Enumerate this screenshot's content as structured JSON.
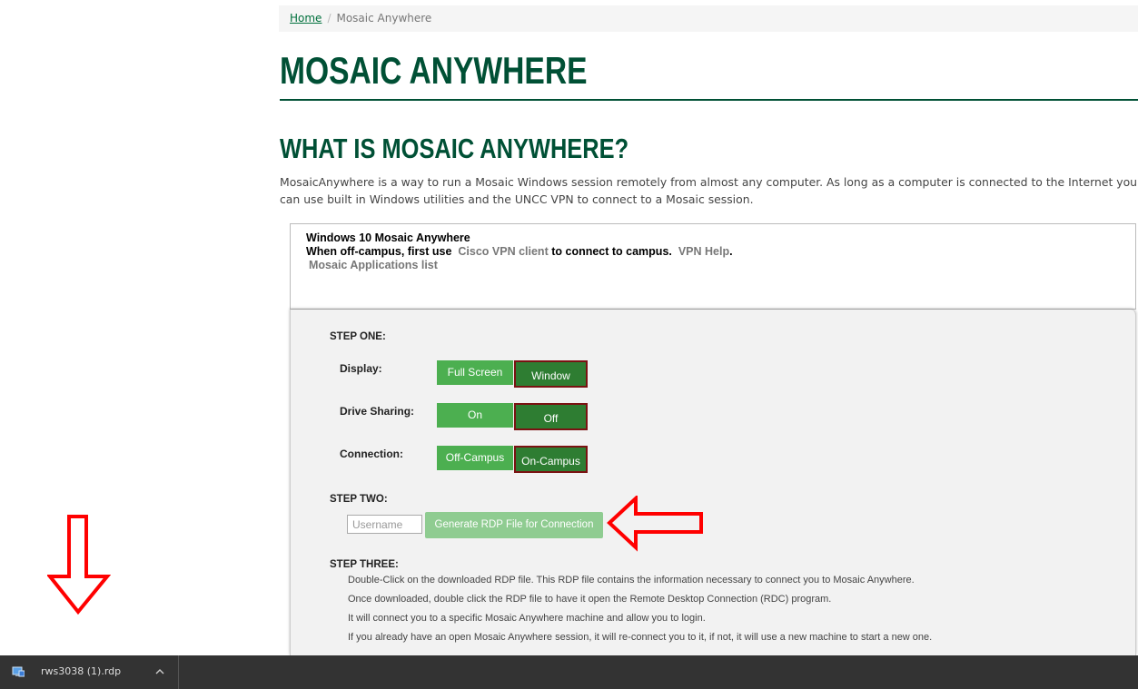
{
  "breadcrumb": {
    "home": "Home",
    "separator": "/",
    "current": "Mosaic Anywhere"
  },
  "page_title": "MOSAIC ANYWHERE",
  "section_title": "WHAT IS MOSAIC ANYWHERE?",
  "intro": "MosaicAnywhere is a way to run a Mosaic Windows session remotely from almost any computer. As long as a computer is connected to the Internet you can use built in Windows utilities and the UNCC VPN to connect to a Mosaic session.",
  "info": {
    "title": "Windows 10 Mosaic Anywhere",
    "line_prefix": "When off-campus, first use",
    "vpn_link": "Cisco VPN client",
    "line_middle": "to connect to campus.",
    "help_link": "VPN Help",
    "line_end": ".",
    "apps_link": "Mosaic Applications list"
  },
  "step_one": {
    "label": "STEP ONE:",
    "display": {
      "label": "Display:",
      "opt1": "Full Screen",
      "opt2": "Window",
      "selected": "Window"
    },
    "drive": {
      "label": "Drive Sharing:",
      "opt1": "On",
      "opt2": "Off",
      "selected": "Off"
    },
    "connection": {
      "label": "Connection:",
      "opt1": "Off-Campus",
      "opt2": "On-Campus",
      "selected": "On-Campus"
    }
  },
  "step_two": {
    "label": "STEP TWO:",
    "username_placeholder": "Username",
    "generate_label": "Generate RDP File for Connection"
  },
  "step_three": {
    "label": "STEP THREE:",
    "lines": [
      "Double-Click on the downloaded RDP file. This RDP file contains the information necessary to connect you to Mosaic Anywhere.",
      "Once downloaded, double click the RDP file to have it open the Remote Desktop Connection (RDC) program.",
      "It will connect you to a specific Mosaic Anywhere machine and allow you to login.",
      "If you already have an open Mosaic Anywhere session, it will re-connect you to it, if not, it will use a new machine to start a new one."
    ]
  },
  "download_bar": {
    "file_name": "rws3038 (1).rdp",
    "icon": "rdp-file-icon"
  },
  "colors": {
    "brand_green": "#005035",
    "button_green": "#4caf50",
    "selected_green": "#2e7d32",
    "arrow_red": "#ff0000"
  }
}
